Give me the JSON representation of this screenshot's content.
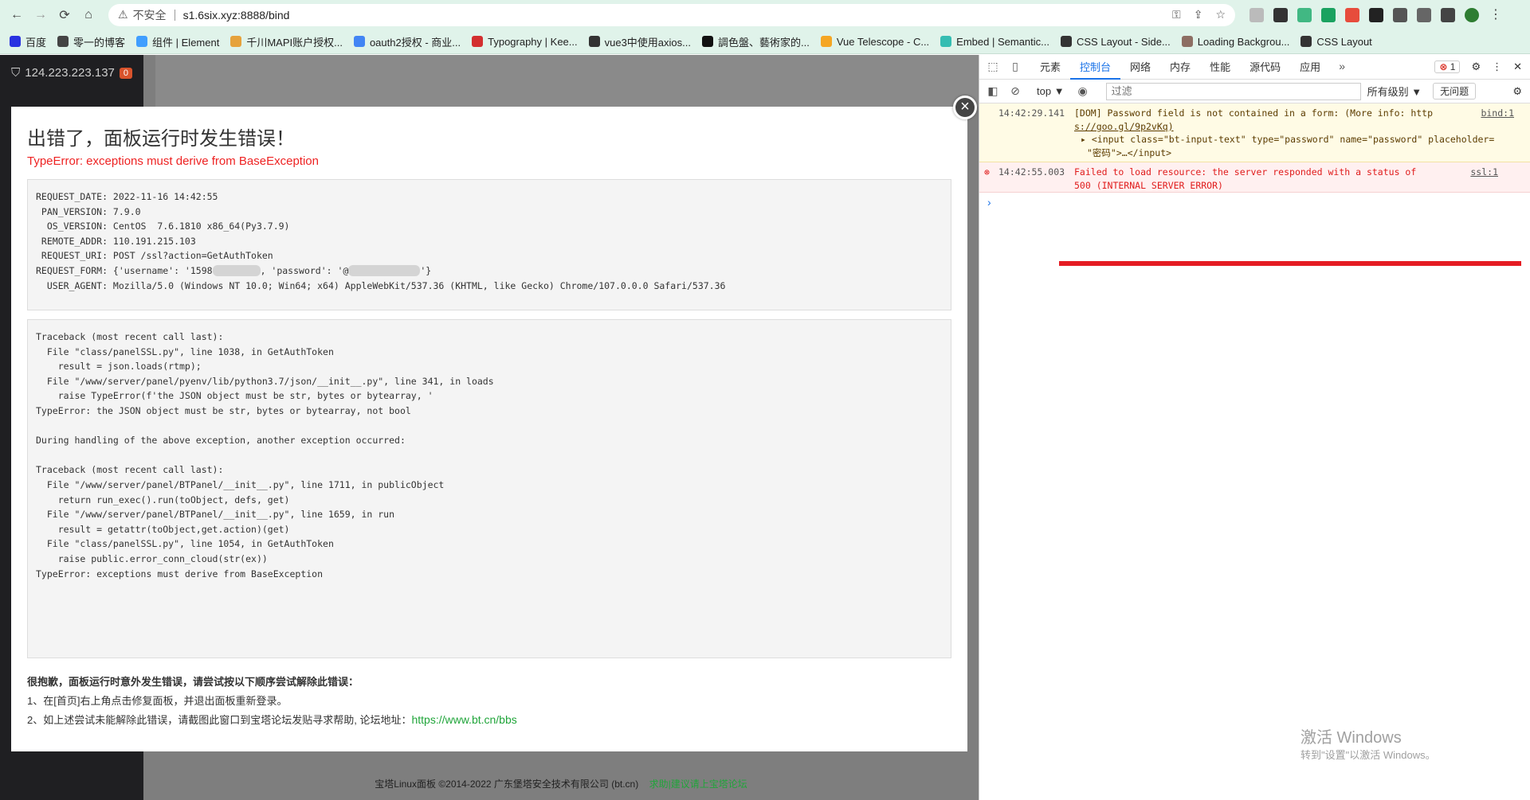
{
  "browser": {
    "insecure_label": "不安全",
    "url": "s1.6six.xyz:8888/bind",
    "bookmarks": [
      "百度",
      "零一的博客",
      "组件 | Element",
      "千川MAPI账户授权...",
      "oauth2授权 - 商业...",
      "Typography | Kee...",
      "vue3中使用axios...",
      "調色盤、藝術家的...",
      "Vue Telescope - C...",
      "Embed | Semantic...",
      "CSS Layout - Side...",
      "Loading Backgrou...",
      "CSS Layout"
    ]
  },
  "panel": {
    "ip": "124.223.223.137",
    "badge": "0",
    "footer_text": "宝塔Linux面板 ©2014-2022 广东堡塔安全技术有限公司 (bt.cn)",
    "footer_link": "求助|建议请上宝塔论坛"
  },
  "modal": {
    "title": "出错了，面板运行时发生错误！",
    "error": "TypeError: exceptions must derive from BaseException",
    "request_lines": [
      "REQUEST_DATE: 2022-11-16 14:42:55",
      " PAN_VERSION: 7.9.0",
      "  OS_VERSION: CentOS  7.6.1810 x86_64(Py3.7.9)",
      " REMOTE_ADDR: 110.191.215.103",
      " REQUEST_URI: POST /ssl?action=GetAuthToken"
    ],
    "request_form_prefix": "REQUEST_FORM: {'username': '1598",
    "request_form_mid": ", 'password': '@",
    "request_form_suffix": "'}",
    "user_agent": "  USER_AGENT: Mozilla/5.0 (Windows NT 10.0; Win64; x64) AppleWebKit/537.36 (KHTML, like Gecko) Chrome/107.0.0.0 Safari/537.36",
    "traceback": "Traceback (most recent call last):\n  File \"class/panelSSL.py\", line 1038, in GetAuthToken\n    result = json.loads(rtmp);\n  File \"/www/server/panel/pyenv/lib/python3.7/json/__init__.py\", line 341, in loads\n    raise TypeError(f'the JSON object must be str, bytes or bytearray, '\nTypeError: the JSON object must be str, bytes or bytearray, not bool\n\nDuring handling of the above exception, another exception occurred:\n\nTraceback (most recent call last):\n  File \"/www/server/panel/BTPanel/__init__.py\", line 1711, in publicObject\n    return run_exec().run(toObject, defs, get)\n  File \"/www/server/panel/BTPanel/__init__.py\", line 1659, in run\n    result = getattr(toObject,get.action)(get)\n  File \"class/panelSSL.py\", line 1054, in GetAuthToken\n    raise public.error_conn_cloud(str(ex))\nTypeError: exceptions must derive from BaseException",
    "sorry": "很抱歉，面板运行时意外发生错误，请尝试按以下顺序尝试解除此错误：",
    "step1": "1、在[首页]右上角点击修复面板，并退出面板重新登录。",
    "step2": "2、如上述尝试未能解除此错误，请截图此窗口到宝塔论坛发贴寻求帮助, 论坛地址：",
    "forum_url": "https://www.bt.cn/bbs"
  },
  "devtools": {
    "tabs": [
      "元素",
      "控制台",
      "网络",
      "内存",
      "性能",
      "源代码",
      "应用"
    ],
    "active_tab": "控制台",
    "error_count": "1",
    "context": "top",
    "filter_placeholder": "过滤",
    "levels": "所有级别",
    "no_issues": "无问题",
    "warn": {
      "time": "14:42:29.141",
      "text": "[DOM] Password field is not contained in a form: (More info: http",
      "text2": "s://goo.gl/9p2vKq)",
      "src": "bind:1",
      "node": "▸ <input class=\"bt-input-text\" type=\"password\" name=\"password\" placeholder=",
      "node2": "\"密码\">…</input>"
    },
    "error": {
      "time": "14:42:55.003",
      "text": "Failed to load resource: the server responded with a status of",
      "text2": "500 (INTERNAL SERVER ERROR)",
      "src": "ssl:1"
    }
  },
  "windows": {
    "line1": "激活 Windows",
    "line2": "转到\"设置\"以激活 Windows。"
  }
}
